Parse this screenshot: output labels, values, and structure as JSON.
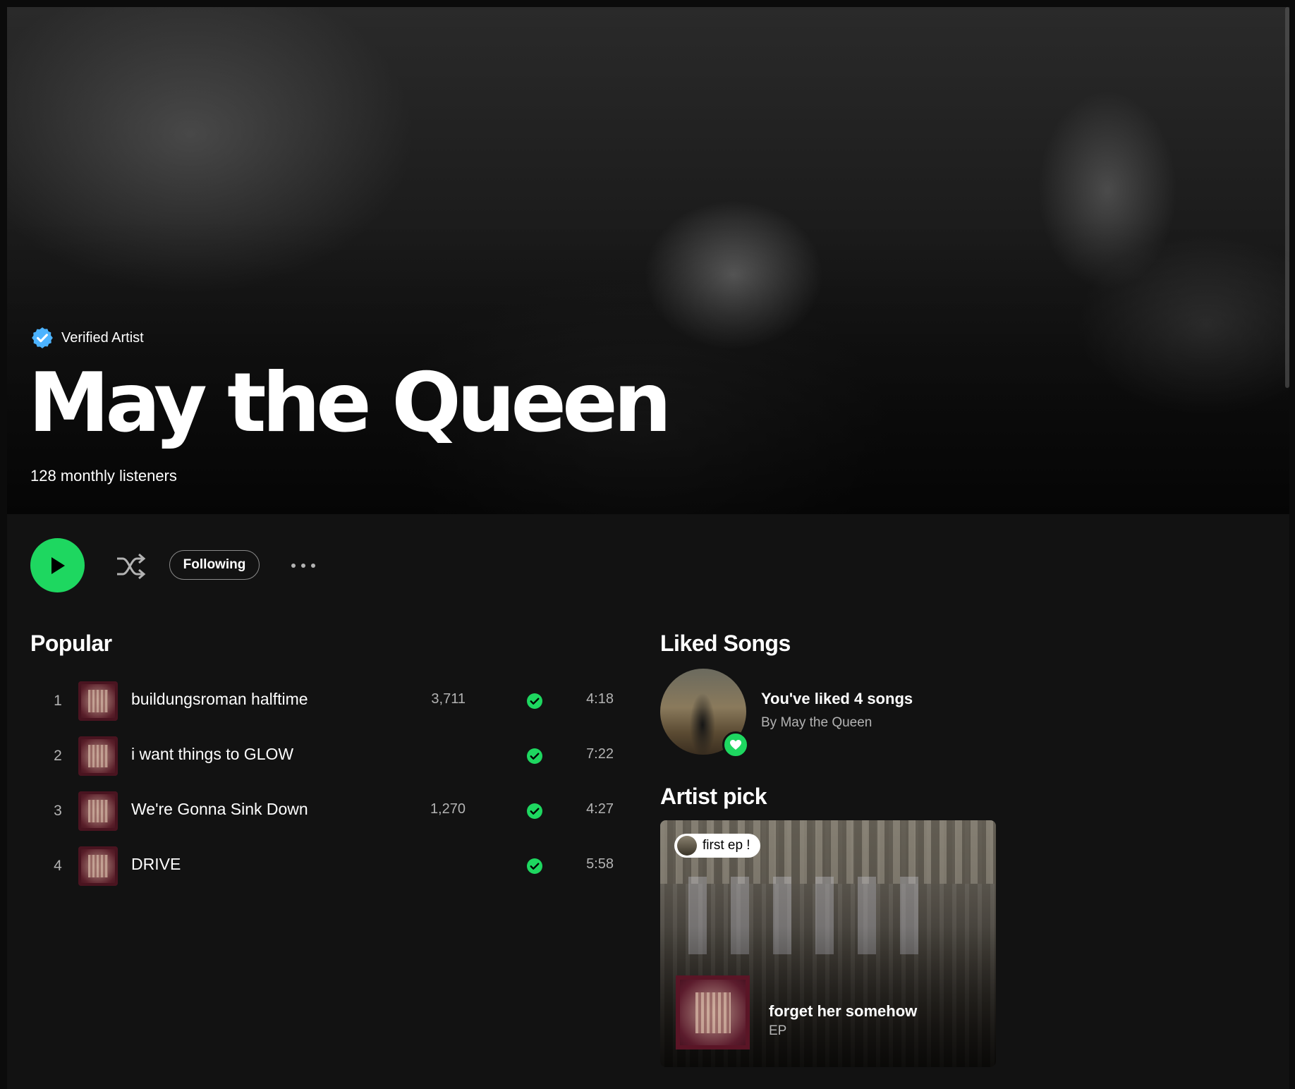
{
  "artist": {
    "verified_label": "Verified Artist",
    "name": "May the Queen",
    "monthly_listeners": "128 monthly listeners"
  },
  "actions": {
    "follow_label": "Following"
  },
  "popular": {
    "title": "Popular",
    "tracks": [
      {
        "num": "1",
        "title": "buildungsroman halftime",
        "plays": "3,711",
        "duration": "4:18",
        "saved": true
      },
      {
        "num": "2",
        "title": "i want things to GLOW",
        "plays": "",
        "duration": "7:22",
        "saved": true
      },
      {
        "num": "3",
        "title": "We're Gonna Sink Down",
        "plays": "1,270",
        "duration": "4:27",
        "saved": true
      },
      {
        "num": "4",
        "title": "DRIVE",
        "plays": "",
        "duration": "5:58",
        "saved": true
      }
    ]
  },
  "liked": {
    "title": "Liked Songs",
    "count_text": "You've liked 4 songs",
    "by_text": "By May the Queen"
  },
  "pick": {
    "title": "Artist pick",
    "badge": "first ep !",
    "release_title": "forget her somehow",
    "release_type": "EP"
  },
  "colors": {
    "accent": "#1ed760",
    "verified": "#4cb3ff",
    "background": "#121212"
  },
  "icons": {
    "verified": "verified-badge-icon",
    "play": "play-icon",
    "shuffle": "shuffle-icon",
    "more": "more-dots-icon",
    "saved": "check-circle-icon",
    "heart": "heart-icon"
  }
}
